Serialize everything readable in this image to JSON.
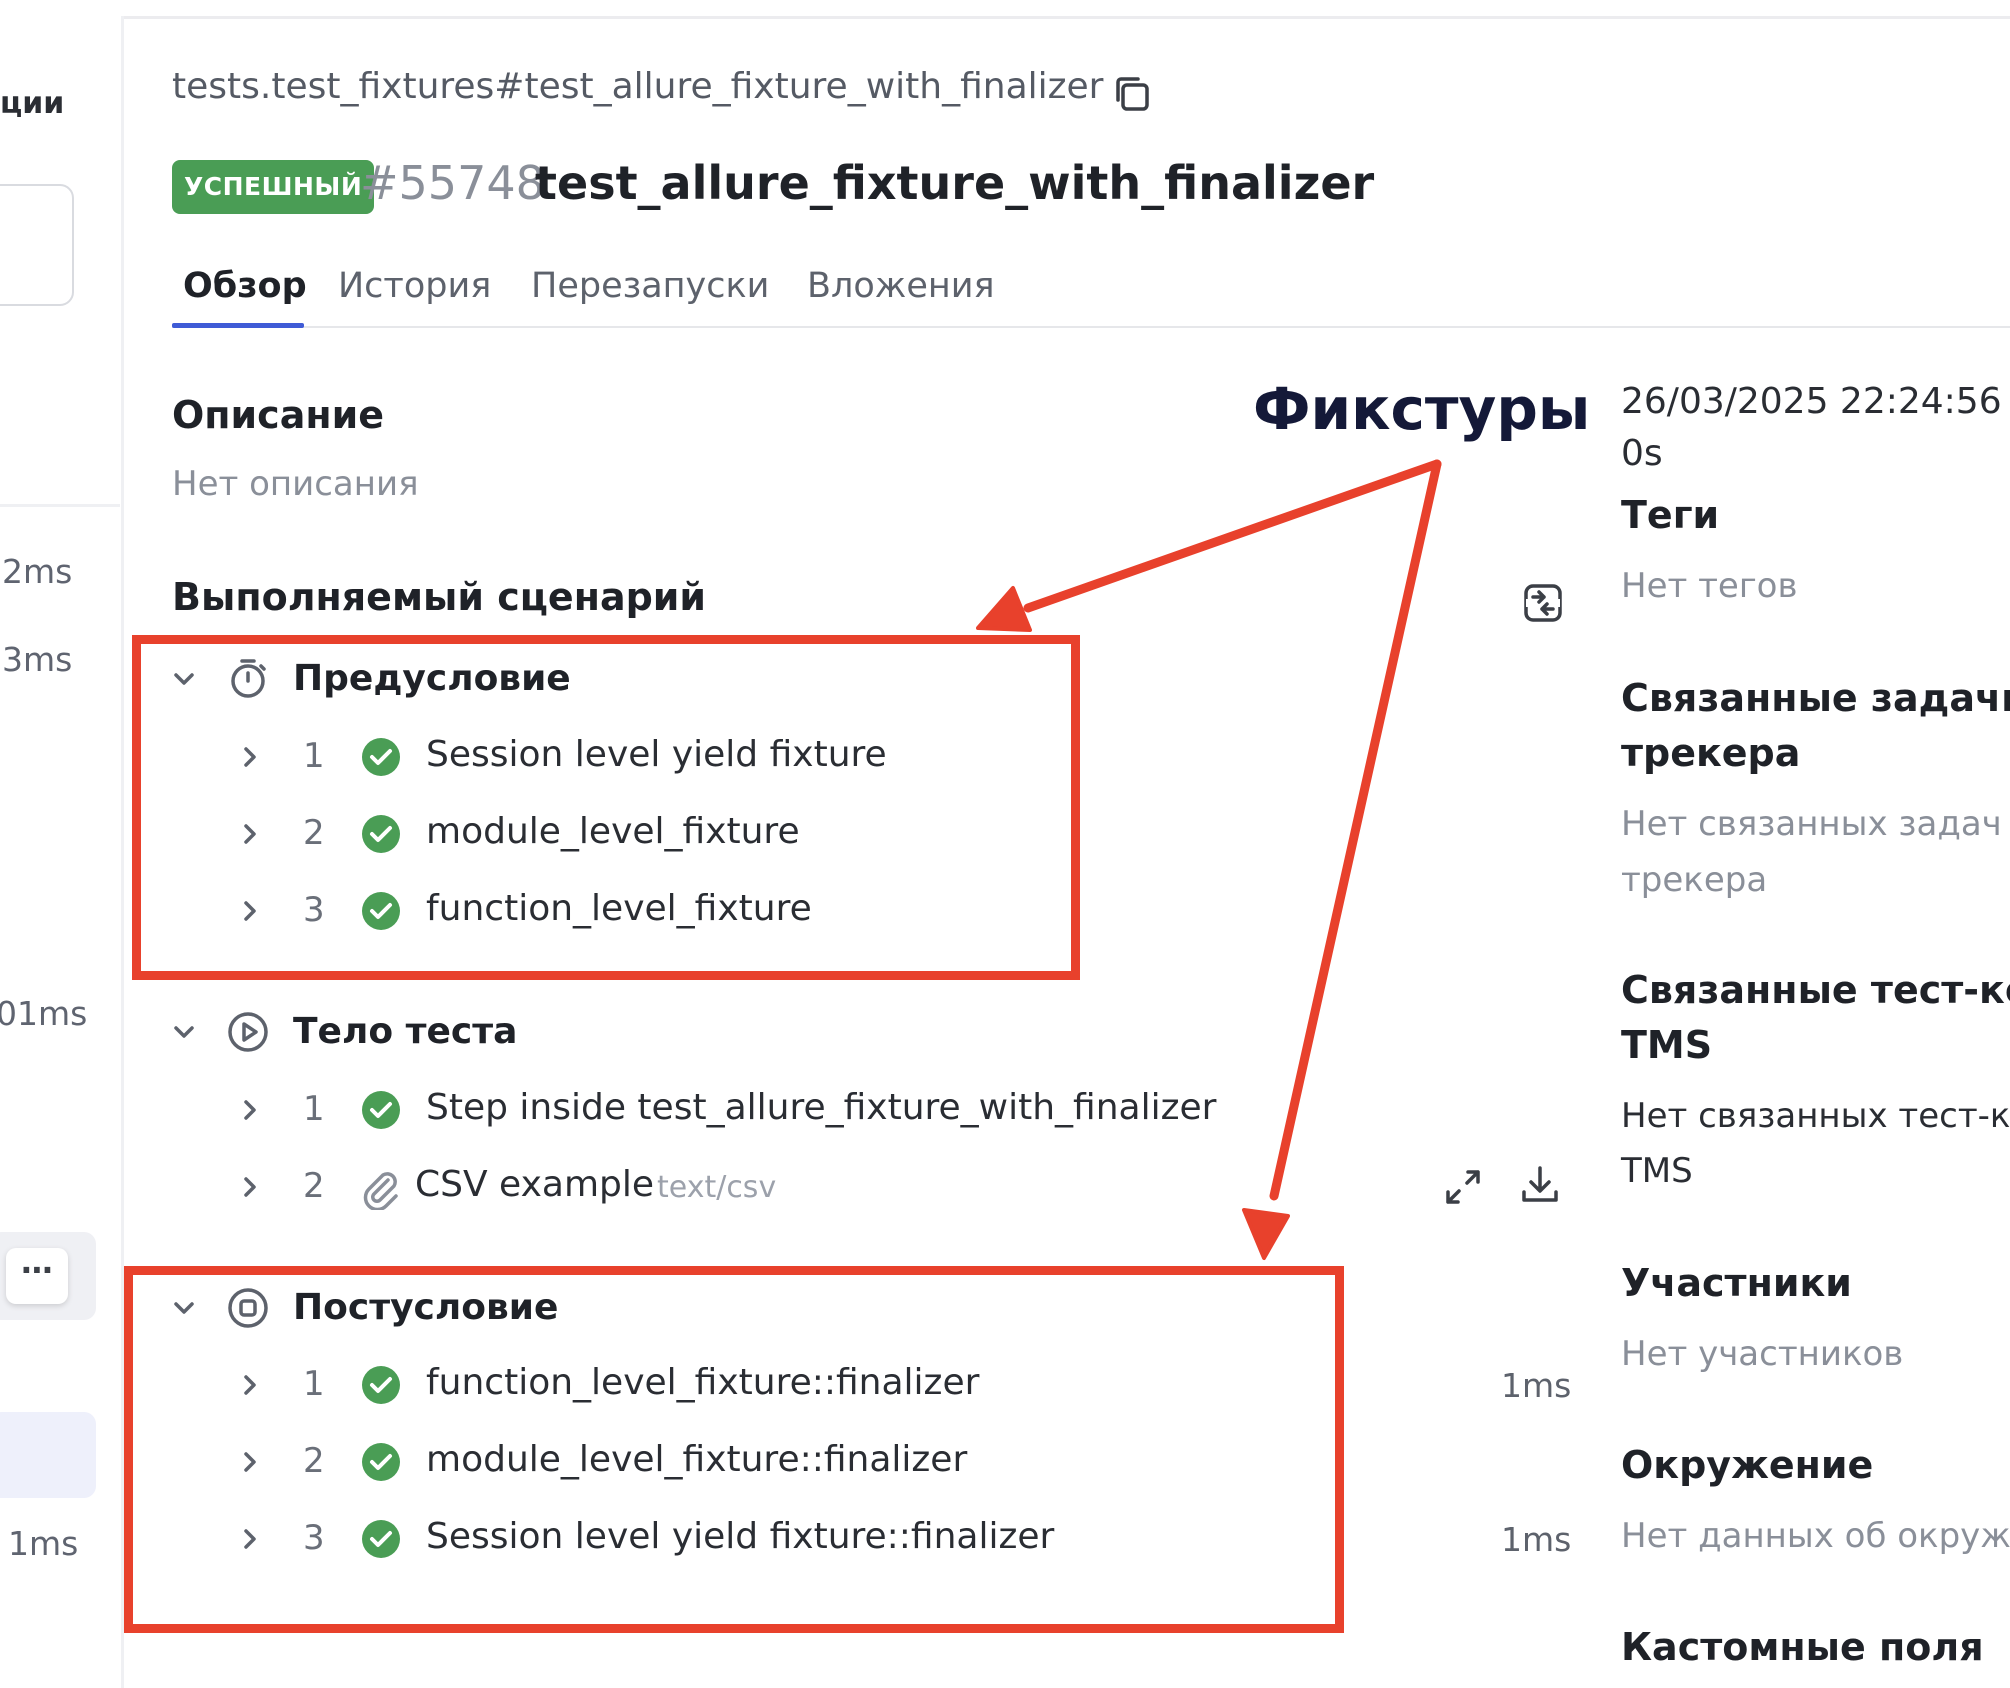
{
  "left_panel": {
    "title_fragment": "ции",
    "durations": [
      "2ms",
      "3ms",
      "01ms",
      "1ms"
    ],
    "more_label": "⋯"
  },
  "header": {
    "breadcrumb": "tests.test_fixtures#test_allure_fixture_with_finalizer",
    "status_badge": "УСПЕШНЫЙ",
    "test_id": "#55748",
    "test_name": "test_allure_fixture_with_finalizer"
  },
  "tabs": [
    {
      "label": "Обзор",
      "active": true
    },
    {
      "label": "История",
      "active": false
    },
    {
      "label": "Перезапуски",
      "active": false
    },
    {
      "label": "Вложения",
      "active": false
    }
  ],
  "description": {
    "title": "Описание",
    "text": "Нет описания"
  },
  "scenario": {
    "title": "Выполняемый сценарий",
    "groups": [
      {
        "title": "Предусловие",
        "icon": "timer-icon",
        "steps": [
          {
            "num": "1",
            "text": "Session level yield fixture",
            "duration": ""
          },
          {
            "num": "2",
            "text": "module_level_fixture",
            "duration": ""
          },
          {
            "num": "3",
            "text": "function_level_fixture",
            "duration": ""
          }
        ]
      },
      {
        "title": "Тело теста",
        "icon": "play-icon",
        "steps": [
          {
            "num": "1",
            "text": "Step inside test_allure_fixture_with_finalizer",
            "duration": ""
          },
          {
            "num": "2",
            "text": "CSV example",
            "attachment_type": "text/csv"
          }
        ]
      },
      {
        "title": "Постусловие",
        "icon": "stop-icon",
        "steps": [
          {
            "num": "1",
            "text": "function_level_fixture::finalizer",
            "duration": "1ms"
          },
          {
            "num": "2",
            "text": "module_level_fixture::finalizer",
            "duration": ""
          },
          {
            "num": "3",
            "text": "Session level yield fixture::finalizer",
            "duration": "1ms"
          }
        ]
      }
    ]
  },
  "annotation": {
    "label": "Фикстуры",
    "color": "#e8412c"
  },
  "right_column": {
    "datetime": "26/03/2025 22:24:56",
    "duration": "0s",
    "tags_title": "Теги",
    "tags_text": "Нет тегов",
    "issues_title_1": "Связанные задачи",
    "issues_title_2": "трекера",
    "issues_text_1": "Нет связанных задач",
    "issues_text_2": "трекера",
    "tms_title_1": "Связанные тест-ке",
    "tms_title_2": "TMS",
    "tms_text_1": "Нет связанных тест-ке",
    "tms_text_2": "TMS",
    "members_title": "Участники",
    "members_text": "Нет участников",
    "env_title": "Окружение",
    "env_text": "Нет данных об окруже",
    "custom_title": "Кастомные поля"
  },
  "colors": {
    "accent": "#3f5bd6",
    "success": "#4a9d55",
    "annotation": "#e8412c"
  }
}
